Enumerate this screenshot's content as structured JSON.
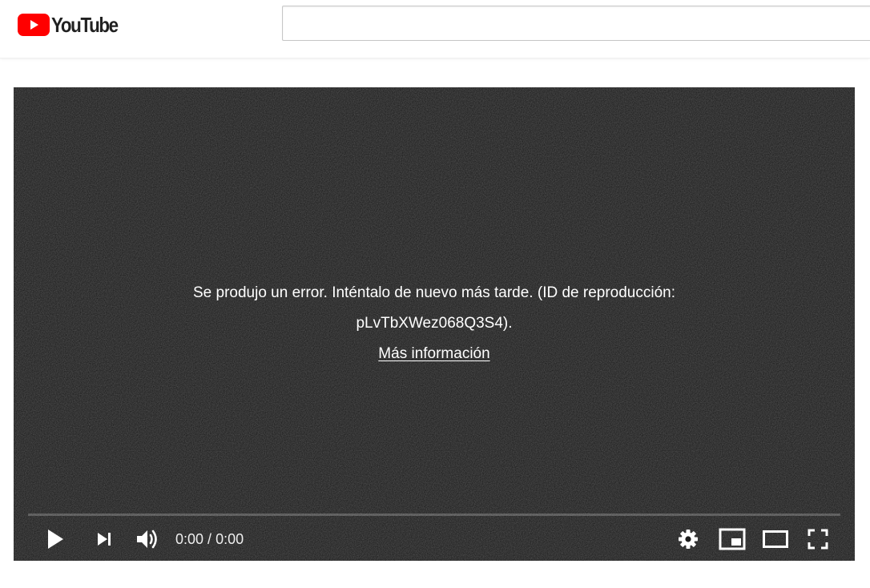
{
  "masthead": {
    "logo_text": "YouTube",
    "logo_icon": "youtube-play-icon",
    "search": {
      "value": "",
      "placeholder": ""
    }
  },
  "player": {
    "error": {
      "line1": "Se produjo un error. Inténtalo de nuevo más tarde. (ID de reproducción:",
      "line2": "pLvTbXWez068Q3S4).",
      "link": "Más información"
    },
    "progress": 0,
    "time": {
      "current": "0:00",
      "separator": " / ",
      "duration": "0:00"
    },
    "icons": {
      "play": "play-icon",
      "next": "next-icon",
      "volume": "volume-icon",
      "settings": "gear-icon",
      "miniplayer": "miniplayer-icon",
      "theater": "theater-mode-icon",
      "fullscreen": "fullscreen-icon"
    }
  },
  "colors": {
    "brand_red": "#ff0000",
    "player_bg": "#1c1c1c",
    "text_dark": "#212121"
  }
}
